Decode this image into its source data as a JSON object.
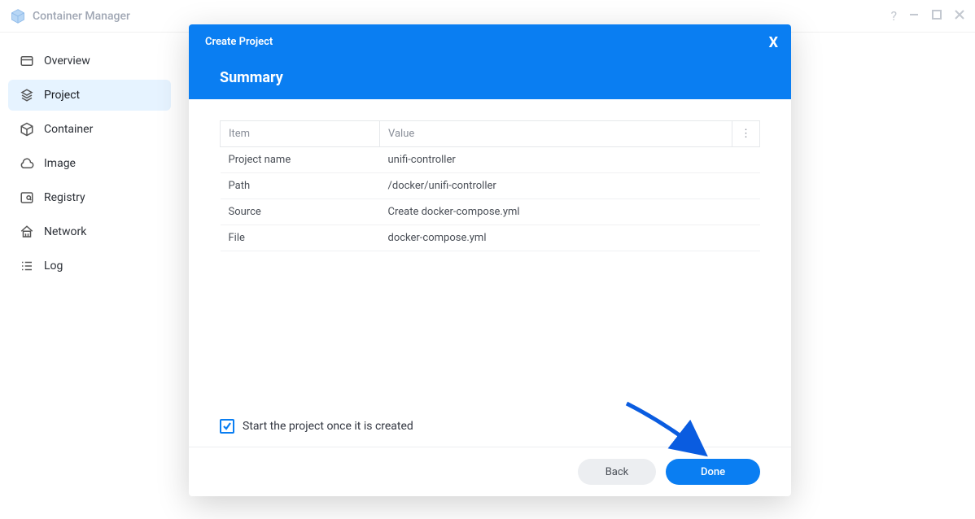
{
  "app": {
    "title": "Container Manager"
  },
  "sidebar": {
    "items": [
      {
        "label": "Overview"
      },
      {
        "label": "Project"
      },
      {
        "label": "Container"
      },
      {
        "label": "Image"
      },
      {
        "label": "Registry"
      },
      {
        "label": "Network"
      },
      {
        "label": "Log"
      }
    ]
  },
  "modal": {
    "title": "Create Project",
    "heading": "Summary",
    "table": {
      "col_item": "Item",
      "col_value": "Value",
      "rows": [
        {
          "item": "Project name",
          "value": "unifi-controller"
        },
        {
          "item": "Path",
          "value": "/docker/unifi-controller"
        },
        {
          "item": "Source",
          "value": "Create docker-compose.yml"
        },
        {
          "item": "File",
          "value": "docker-compose.yml"
        }
      ]
    },
    "start_checkbox_label": "Start the project once it is created",
    "back_label": "Back",
    "done_label": "Done"
  }
}
